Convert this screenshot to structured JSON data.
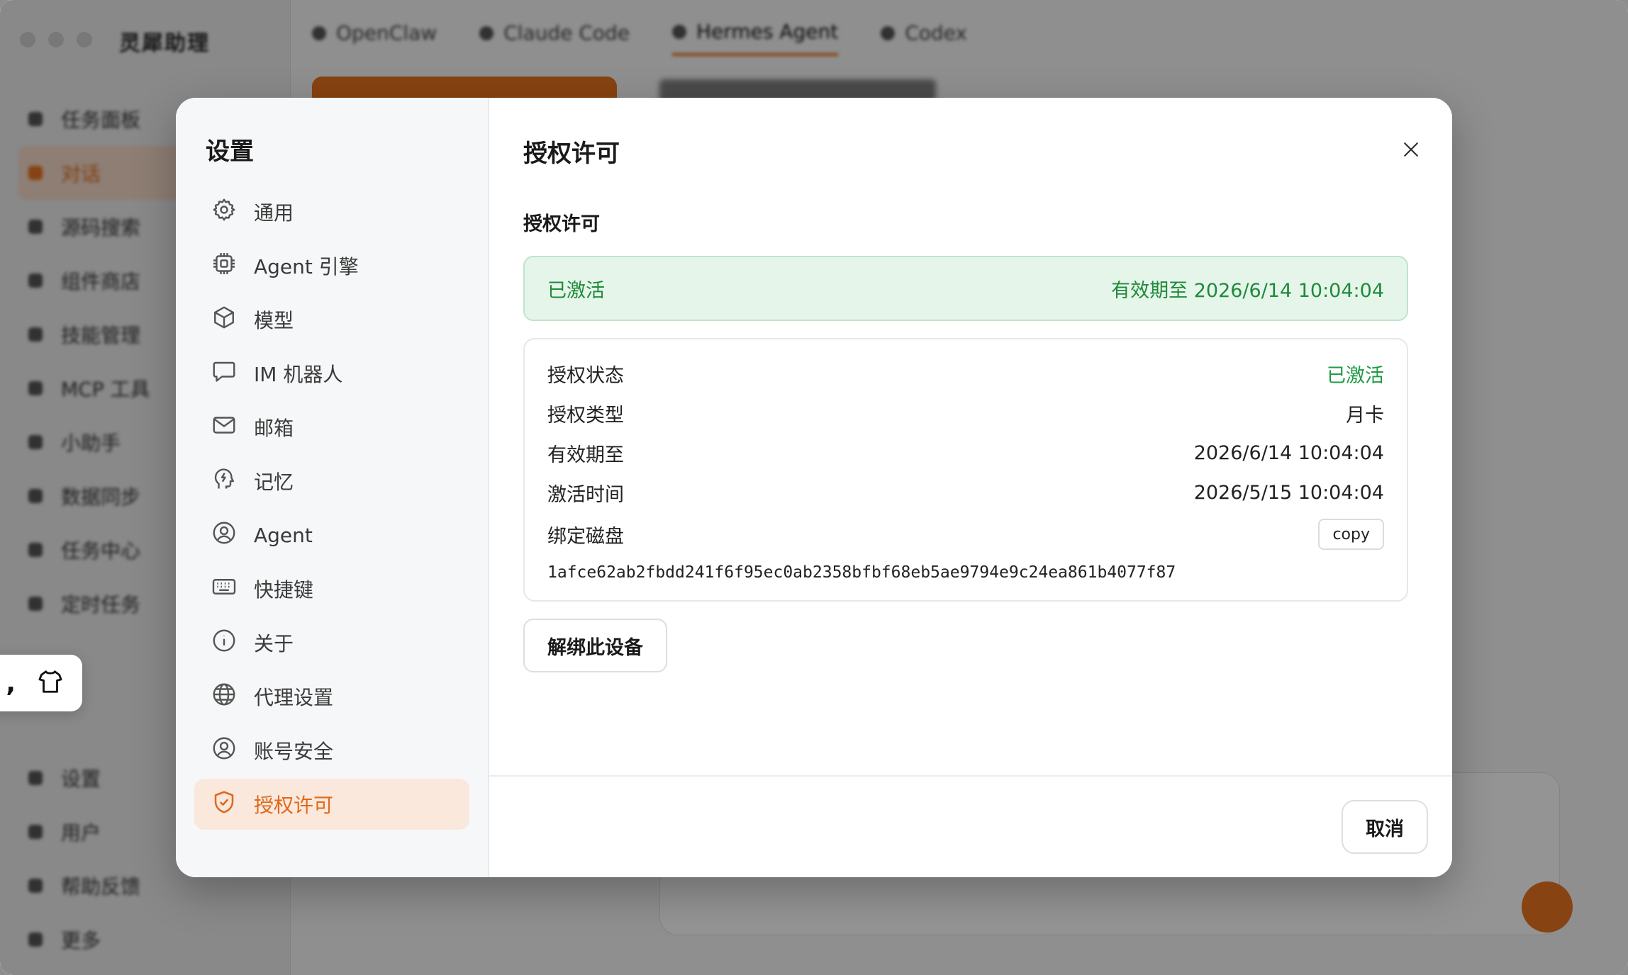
{
  "background_app": {
    "brand": "灵犀助理",
    "nav": [
      "任务面板",
      "对话",
      "源码搜索",
      "组件商店",
      "技能管理",
      "MCP 工具",
      "小助手",
      "数据同步",
      "任务中心",
      "定时任务"
    ],
    "nav_bottom": [
      "设置",
      "用户",
      "帮助反馈",
      "更多"
    ],
    "tabs": [
      "OpenClaw",
      "Claude Code",
      "Hermes Agent",
      "Codex"
    ],
    "active_tab": "Hermes Agent"
  },
  "sidebar": {
    "title": "设置",
    "items": [
      {
        "label": "通用",
        "icon": "gear-icon"
      },
      {
        "label": "Agent 引擎",
        "icon": "cpu-icon"
      },
      {
        "label": "模型",
        "icon": "cube-icon"
      },
      {
        "label": "IM 机器人",
        "icon": "chat-bubble-icon"
      },
      {
        "label": "邮箱",
        "icon": "mail-icon"
      },
      {
        "label": "记忆",
        "icon": "brain-bolt-icon"
      },
      {
        "label": "Agent",
        "icon": "user-circle-icon"
      },
      {
        "label": "快捷键",
        "icon": "keyboard-icon"
      },
      {
        "label": "关于",
        "icon": "info-icon"
      },
      {
        "label": "代理设置",
        "icon": "globe-icon"
      },
      {
        "label": "账号安全",
        "icon": "user-circle-icon"
      },
      {
        "label": "授权许可",
        "icon": "shield-check-icon",
        "active": true
      }
    ]
  },
  "main": {
    "title": "授权许可",
    "section_title": "授权许可",
    "banner": {
      "status": "已激活",
      "expiry": "有效期至 2026/6/14 10:04:04"
    },
    "info": {
      "status_label": "授权状态",
      "status_value": "已激活",
      "type_label": "授权类型",
      "type_value": "月卡",
      "expiry_label": "有效期至",
      "expiry_value": "2026/6/14 10:04:04",
      "activated_label": "激活时间",
      "activated_value": "2026/5/15 10:04:04",
      "disk_label": "绑定磁盘",
      "copy_label": "copy",
      "disk_id": "1afce62ab2fbdd241f6f95ec0ab2358bfbf68eb5ae9794e9c24ea861b4077f87"
    },
    "unbind_label": "解绑此设备",
    "cancel_label": "取消"
  },
  "colors": {
    "accent": "#e0691a",
    "success": "#1f8a3b",
    "success_bg": "#e6f5ea"
  }
}
